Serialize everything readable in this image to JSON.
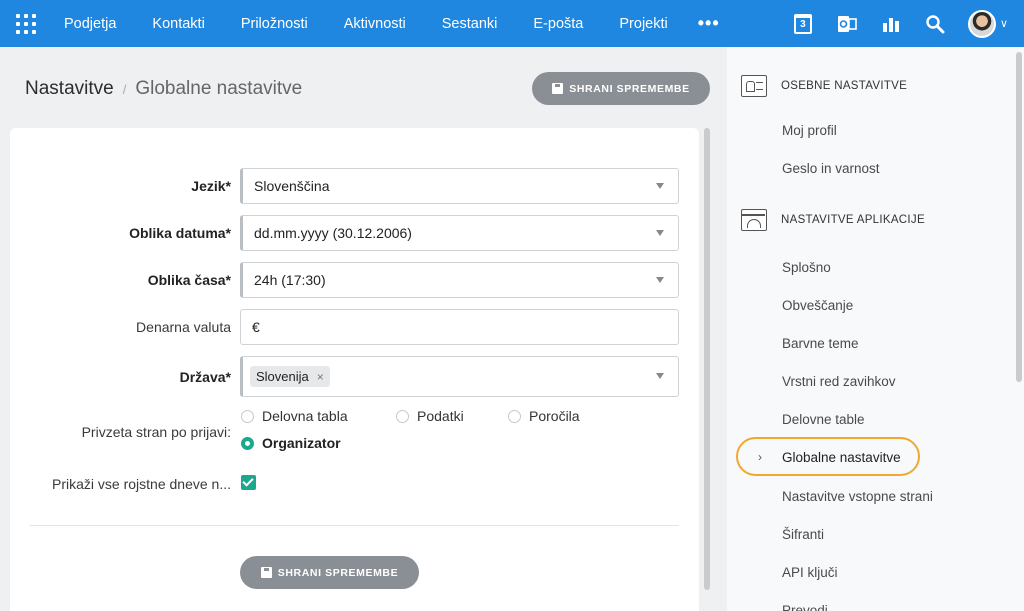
{
  "topnav": {
    "items": [
      "Podjetja",
      "Kontakti",
      "Priložnosti",
      "Aktivnosti",
      "Sestanki",
      "E-pošta",
      "Projekti"
    ],
    "more": "•••",
    "calendar_day": "3",
    "icons": [
      "calendar-icon",
      "outlook-icon",
      "reports-icon",
      "search-icon"
    ]
  },
  "breadcrumb": {
    "root": "Nastavitve",
    "separator": "/",
    "current": "Globalne nastavitve"
  },
  "save_button_label": "SHRANI SPREMEMBE",
  "form": {
    "language": {
      "label": "Jezik*",
      "value": "Slovenščina"
    },
    "date_format": {
      "label": "Oblika datuma*",
      "value": "dd.mm.yyyy (30.12.2006)"
    },
    "time_format": {
      "label": "Oblika časa*",
      "value": "24h (17:30)"
    },
    "currency": {
      "label": "Denarna valuta",
      "value": "€"
    },
    "country": {
      "label": "Država*",
      "tag": "Slovenija",
      "tag_remove": "×"
    },
    "landing_page": {
      "label": "Privzeta stran po prijavi:",
      "options": [
        "Delovna tabla",
        "Podatki",
        "Poročila",
        "Organizator"
      ],
      "selected": "Organizator"
    },
    "show_birthdays": {
      "label": "Prikaži vse rojstne dneve n...",
      "checked": true
    }
  },
  "sidebar": {
    "personal": {
      "title": "OSEBNE NASTAVITVE",
      "items": [
        "Moj profil",
        "Geslo in varnost"
      ]
    },
    "app": {
      "title": "NASTAVITVE APLIKACIJE",
      "items": [
        "Splošno",
        "Obveščanje",
        "Barvne teme",
        "Vrstni red zavihkov",
        "Delovne table",
        "Globalne nastavitve",
        "Nastavitve vstopne strani",
        "Šifranti",
        "API ključi",
        "Prevodi"
      ],
      "active": "Globalne nastavitve"
    }
  },
  "colors": {
    "topbar": "#1f87e0",
    "accent_green": "#1ba88e",
    "highlight_ring": "#f0a830",
    "button_gray": "#8a8f96"
  }
}
